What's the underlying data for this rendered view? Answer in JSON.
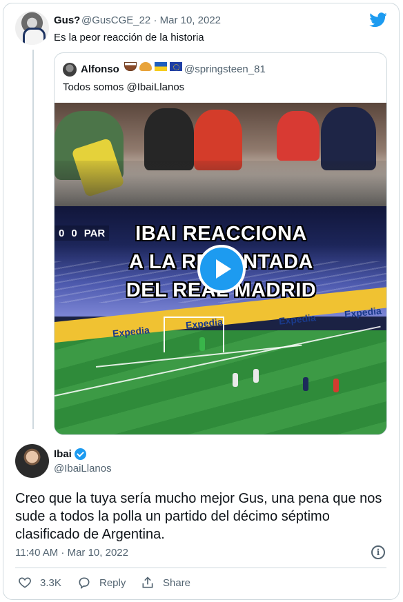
{
  "top_tweet": {
    "name": "Gus?",
    "handle": "@GusCGE_22",
    "separator": "·",
    "date": "Mar 10, 2022",
    "text": "Es la peor reacción de la historia"
  },
  "quoted_tweet": {
    "name": "Alfonso",
    "emoji": [
      "coffee-emoji",
      "croissant-emoji",
      "ukraine-flag-emoji",
      "eu-flag-emoji"
    ],
    "handle": "@springsteen_81",
    "text": "Todos somos @IbaiLlanos",
    "video": {
      "scoreboard": [
        "0",
        "0",
        "PAR"
      ],
      "title_lines": [
        "IBAI REACCIONA",
        "A LA REMONTADA",
        "DEL REAL MADRID"
      ],
      "banner": [
        "Expedia",
        "Expedia",
        "Expedia",
        "Expedia"
      ]
    }
  },
  "main_tweet": {
    "name": "Ibai",
    "handle": "@IbaiLlanos",
    "text": "Creo que la tuya sería mucho mejor Gus, una pena que nos sude a todos la polla un partido del décimo séptimo clasificado de Argentina.",
    "timestamp": "11:40 AM · Mar 10, 2022",
    "info_symbol": "i",
    "actions": {
      "like_count": "3.3K",
      "reply_label": "Reply",
      "share_label": "Share"
    }
  },
  "colors": {
    "accent": "#1d9bf0",
    "secondary_text": "#536471",
    "border": "#cfd9de"
  }
}
